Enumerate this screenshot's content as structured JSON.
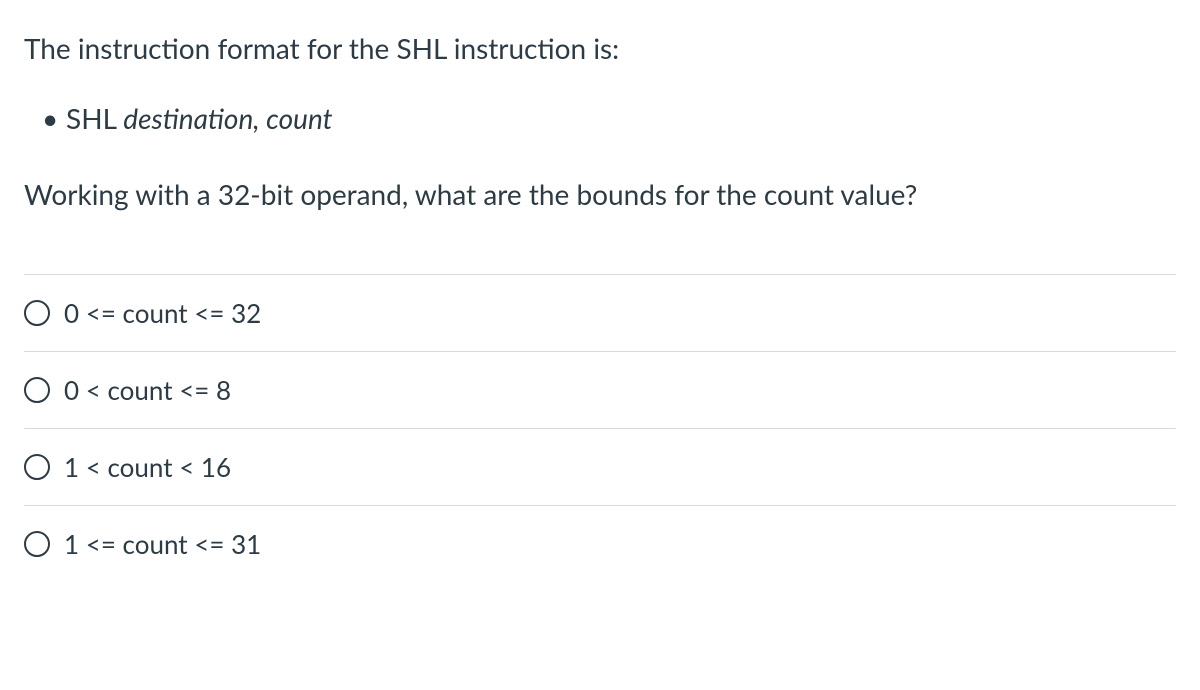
{
  "question": {
    "intro": "The instruction format for the SHL instruction is:",
    "bullet_prefix": "SHL ",
    "bullet_italic": "destination, count",
    "prompt": "Working with a 32-bit operand, what are the bounds for the count value?"
  },
  "options": [
    {
      "label": "0 <= count <= 32"
    },
    {
      "label": "0 < count <= 8"
    },
    {
      "label": "1 < count < 16"
    },
    {
      "label": "1 <= count <= 31"
    }
  ]
}
